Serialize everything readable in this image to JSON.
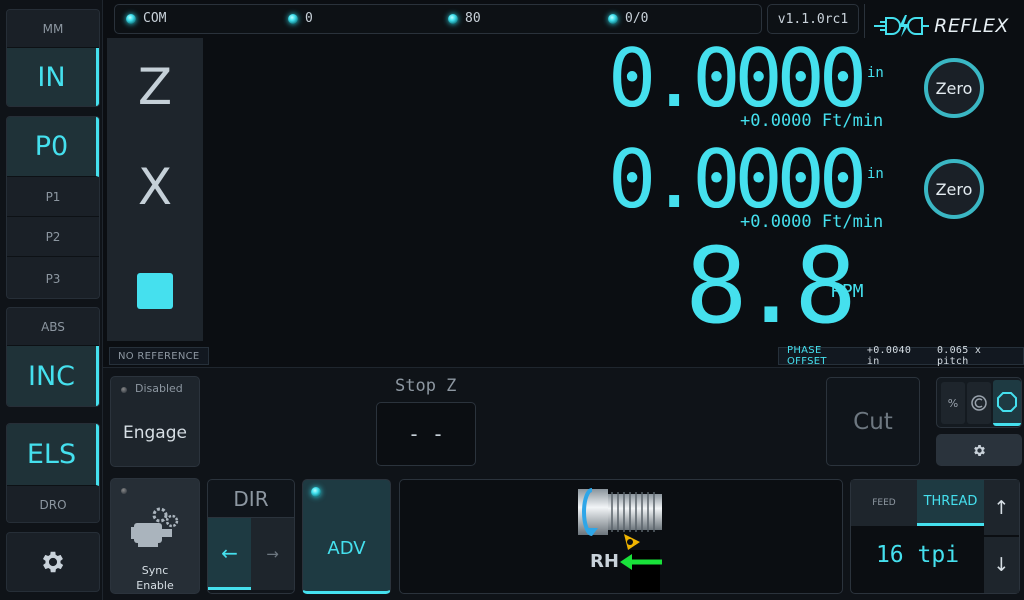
{
  "sidebar": {
    "mm": "MM",
    "in": "IN",
    "p0": "P0",
    "p1": "P1",
    "p2": "P2",
    "p3": "P3",
    "abs": "ABS",
    "inc": "INC",
    "els": "ELS",
    "dro": "DRO",
    "settings_icon": "gear-icon"
  },
  "status": {
    "com_label": "COM",
    "value1": "0",
    "value2": "80",
    "value3": "0/0",
    "led_color": "#45e0ee"
  },
  "version": "v1.1.0rc1",
  "logo": {
    "text": "REFLEX",
    "icon": "plug-bolt-icon"
  },
  "axes": {
    "z_label": "Z",
    "x_label": "X"
  },
  "readouts": {
    "z": {
      "value": "0.0000",
      "unit": "in",
      "rate": "+0.0000 Ft/min",
      "zero_label": "Zero"
    },
    "x": {
      "value": "0.0000",
      "unit": "in",
      "rate": "+0.0000 Ft/min",
      "zero_label": "Zero"
    },
    "spindle": {
      "value": "8.8",
      "unit": "RPM"
    }
  },
  "info": {
    "reference": "NO REFERENCE",
    "phase_label": "PHASE OFFSET",
    "phase_value": "+0.0040 in",
    "pitch_value": "0.065 x pitch"
  },
  "controls": {
    "engage_status": "Disabled",
    "engage_label": "Engage",
    "stop_label": "Stop Z",
    "stop_value": "- -",
    "cut_label": "Cut",
    "mode_icons": [
      "percent-icon",
      "spiral-icon",
      "hexagon-icon"
    ],
    "settings_icon": "gear-icon",
    "sync_label_1": "Sync",
    "sync_label_2": "Enable",
    "dir_label": "DIR",
    "dir_left": "←",
    "dir_right": "→",
    "adv_label": "ADV",
    "thread_hand": "RH",
    "feed_tab": "FEED",
    "thread_tab": "THREAD",
    "pitch_value": "16 tpi",
    "up_icon": "↑",
    "down_icon": "↓"
  },
  "colors": {
    "accent": "#45e0ee",
    "background": "#0b0e12",
    "panel": "#1e252c",
    "arrow_green": "#19e23a",
    "tool_yellow": "#f0b400"
  }
}
